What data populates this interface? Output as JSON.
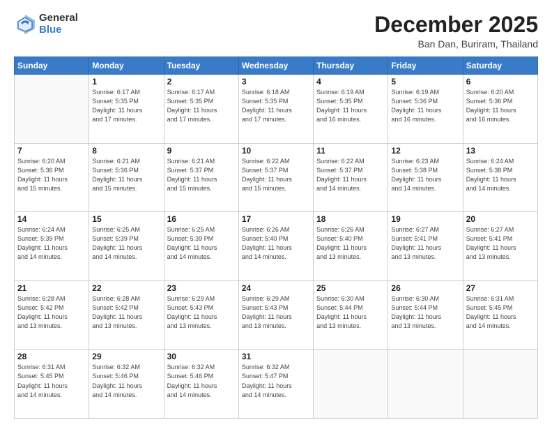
{
  "header": {
    "logo_general": "General",
    "logo_blue": "Blue",
    "month_title": "December 2025",
    "location": "Ban Dan, Buriram, Thailand"
  },
  "days_of_week": [
    "Sunday",
    "Monday",
    "Tuesday",
    "Wednesday",
    "Thursday",
    "Friday",
    "Saturday"
  ],
  "weeks": [
    [
      {
        "day": "",
        "info": ""
      },
      {
        "day": "1",
        "info": "Sunrise: 6:17 AM\nSunset: 5:35 PM\nDaylight: 11 hours\nand 17 minutes."
      },
      {
        "day": "2",
        "info": "Sunrise: 6:17 AM\nSunset: 5:35 PM\nDaylight: 11 hours\nand 17 minutes."
      },
      {
        "day": "3",
        "info": "Sunrise: 6:18 AM\nSunset: 5:35 PM\nDaylight: 11 hours\nand 17 minutes."
      },
      {
        "day": "4",
        "info": "Sunrise: 6:19 AM\nSunset: 5:35 PM\nDaylight: 11 hours\nand 16 minutes."
      },
      {
        "day": "5",
        "info": "Sunrise: 6:19 AM\nSunset: 5:36 PM\nDaylight: 11 hours\nand 16 minutes."
      },
      {
        "day": "6",
        "info": "Sunrise: 6:20 AM\nSunset: 5:36 PM\nDaylight: 11 hours\nand 16 minutes."
      }
    ],
    [
      {
        "day": "7",
        "info": "Sunrise: 6:20 AM\nSunset: 5:36 PM\nDaylight: 11 hours\nand 15 minutes."
      },
      {
        "day": "8",
        "info": "Sunrise: 6:21 AM\nSunset: 5:36 PM\nDaylight: 11 hours\nand 15 minutes."
      },
      {
        "day": "9",
        "info": "Sunrise: 6:21 AM\nSunset: 5:37 PM\nDaylight: 11 hours\nand 15 minutes."
      },
      {
        "day": "10",
        "info": "Sunrise: 6:22 AM\nSunset: 5:37 PM\nDaylight: 11 hours\nand 15 minutes."
      },
      {
        "day": "11",
        "info": "Sunrise: 6:22 AM\nSunset: 5:37 PM\nDaylight: 11 hours\nand 14 minutes."
      },
      {
        "day": "12",
        "info": "Sunrise: 6:23 AM\nSunset: 5:38 PM\nDaylight: 11 hours\nand 14 minutes."
      },
      {
        "day": "13",
        "info": "Sunrise: 6:24 AM\nSunset: 5:38 PM\nDaylight: 11 hours\nand 14 minutes."
      }
    ],
    [
      {
        "day": "14",
        "info": "Sunrise: 6:24 AM\nSunset: 5:39 PM\nDaylight: 11 hours\nand 14 minutes."
      },
      {
        "day": "15",
        "info": "Sunrise: 6:25 AM\nSunset: 5:39 PM\nDaylight: 11 hours\nand 14 minutes."
      },
      {
        "day": "16",
        "info": "Sunrise: 6:25 AM\nSunset: 5:39 PM\nDaylight: 11 hours\nand 14 minutes."
      },
      {
        "day": "17",
        "info": "Sunrise: 6:26 AM\nSunset: 5:40 PM\nDaylight: 11 hours\nand 14 minutes."
      },
      {
        "day": "18",
        "info": "Sunrise: 6:26 AM\nSunset: 5:40 PM\nDaylight: 11 hours\nand 13 minutes."
      },
      {
        "day": "19",
        "info": "Sunrise: 6:27 AM\nSunset: 5:41 PM\nDaylight: 11 hours\nand 13 minutes."
      },
      {
        "day": "20",
        "info": "Sunrise: 6:27 AM\nSunset: 5:41 PM\nDaylight: 11 hours\nand 13 minutes."
      }
    ],
    [
      {
        "day": "21",
        "info": "Sunrise: 6:28 AM\nSunset: 5:42 PM\nDaylight: 11 hours\nand 13 minutes."
      },
      {
        "day": "22",
        "info": "Sunrise: 6:28 AM\nSunset: 5:42 PM\nDaylight: 11 hours\nand 13 minutes."
      },
      {
        "day": "23",
        "info": "Sunrise: 6:29 AM\nSunset: 5:43 PM\nDaylight: 11 hours\nand 13 minutes."
      },
      {
        "day": "24",
        "info": "Sunrise: 6:29 AM\nSunset: 5:43 PM\nDaylight: 11 hours\nand 13 minutes."
      },
      {
        "day": "25",
        "info": "Sunrise: 6:30 AM\nSunset: 5:44 PM\nDaylight: 11 hours\nand 13 minutes."
      },
      {
        "day": "26",
        "info": "Sunrise: 6:30 AM\nSunset: 5:44 PM\nDaylight: 11 hours\nand 13 minutes."
      },
      {
        "day": "27",
        "info": "Sunrise: 6:31 AM\nSunset: 5:45 PM\nDaylight: 11 hours\nand 14 minutes."
      }
    ],
    [
      {
        "day": "28",
        "info": "Sunrise: 6:31 AM\nSunset: 5:45 PM\nDaylight: 11 hours\nand 14 minutes."
      },
      {
        "day": "29",
        "info": "Sunrise: 6:32 AM\nSunset: 5:46 PM\nDaylight: 11 hours\nand 14 minutes."
      },
      {
        "day": "30",
        "info": "Sunrise: 6:32 AM\nSunset: 5:46 PM\nDaylight: 11 hours\nand 14 minutes."
      },
      {
        "day": "31",
        "info": "Sunrise: 6:32 AM\nSunset: 5:47 PM\nDaylight: 11 hours\nand 14 minutes."
      },
      {
        "day": "",
        "info": ""
      },
      {
        "day": "",
        "info": ""
      },
      {
        "day": "",
        "info": ""
      }
    ]
  ]
}
